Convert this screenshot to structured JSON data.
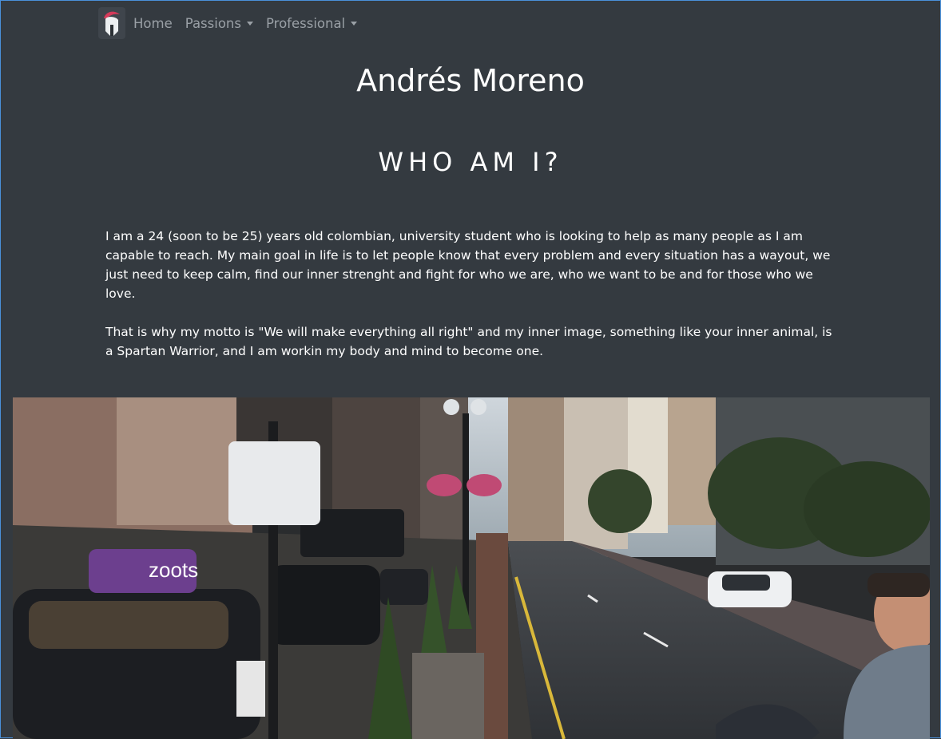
{
  "nav": {
    "brand_icon": "spartan-helmet-icon",
    "items": [
      {
        "label": "Home",
        "has_dropdown": false
      },
      {
        "label": "Passions",
        "has_dropdown": true
      },
      {
        "label": "Professional",
        "has_dropdown": true
      }
    ]
  },
  "header": {
    "name": "Andrés Moreno",
    "section_title": "WHO AM I?"
  },
  "bio": {
    "paragraph1": "I am a 24 (soon to be 25) years old colombian, university student who is looking to help as many people as I am capable to reach. My main goal in life is to let people know that every problem and every situation has a wayout, we just need to keep calm, find our inner strenght and fight for who we are, who we want to be and for those who we love.",
    "paragraph2": "That is why my motto is \"We will make everything all right\" and my inner image, something like your inner animal, is a Spartan Warrior, and I am workin my body and mind to become one."
  },
  "photo": {
    "sign_text": "zoots"
  },
  "colors": {
    "background": "#343a40",
    "nav_text": "#9aa0a6",
    "heading_text": "#ffffff",
    "helmet_crest": "#d43a5a"
  }
}
